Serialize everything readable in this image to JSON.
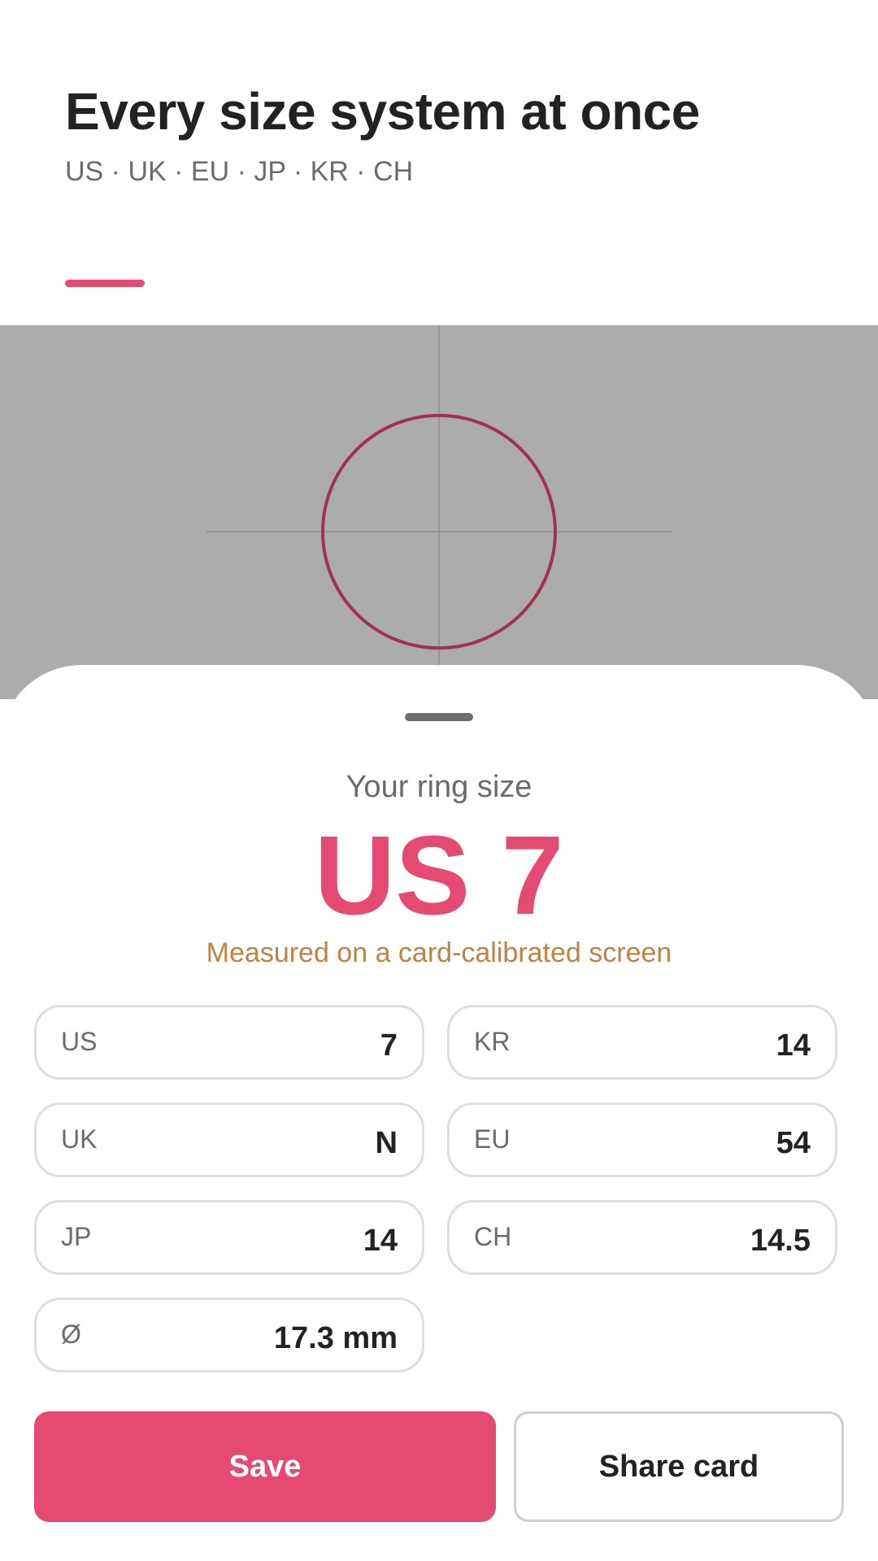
{
  "header": {
    "title": "Every size system at once",
    "subtitle": "US · UK · EU · JP · KR · CH",
    "accent_color": "#e44a72"
  },
  "viewport": {
    "background_color": "#acacac",
    "ring_color": "#a3304f",
    "crosshair_color": "#8e8e8e"
  },
  "result": {
    "caption": "Your ring size",
    "size": "US 7",
    "note": "Measured on a card-calibrated screen"
  },
  "sizes": [
    {
      "label": "US",
      "value": "7"
    },
    {
      "label": "KR",
      "value": "14"
    },
    {
      "label": "UK",
      "value": "N"
    },
    {
      "label": "EU",
      "value": "54"
    },
    {
      "label": "JP",
      "value": "14"
    },
    {
      "label": "CH",
      "value": "14.5"
    },
    {
      "label": "Ø",
      "value": "17.3 mm"
    }
  ],
  "actions": {
    "save_label": "Save",
    "share_label": "Share card"
  }
}
